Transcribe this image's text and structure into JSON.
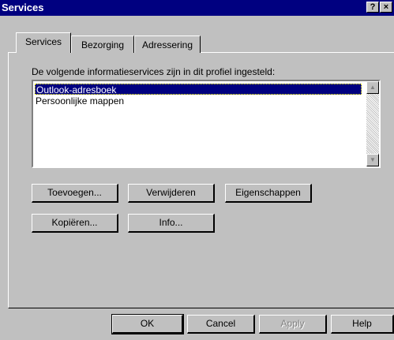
{
  "window": {
    "title": "Services",
    "help_glyph": "?",
    "close_glyph": "×"
  },
  "tabs": [
    {
      "label": "Services",
      "active": true
    },
    {
      "label": "Bezorging",
      "active": false
    },
    {
      "label": "Adressering",
      "active": false
    }
  ],
  "services": {
    "label": "De volgende informatieservices zijn in dit profiel ingesteld:",
    "items": [
      {
        "label": "Outlook-adresboek",
        "selected": true
      },
      {
        "label": "Persoonlijke mappen",
        "selected": false
      }
    ]
  },
  "scrollbar": {
    "up_glyph": "▲",
    "down_glyph": "▼"
  },
  "actions": {
    "add": "Toevoegen...",
    "remove": "Verwijderen",
    "properties": "Eigenschappen",
    "copy": "Kopiëren...",
    "info": "Info..."
  },
  "footer": {
    "ok": "OK",
    "cancel": "Cancel",
    "apply": "Apply",
    "help": "Help"
  }
}
